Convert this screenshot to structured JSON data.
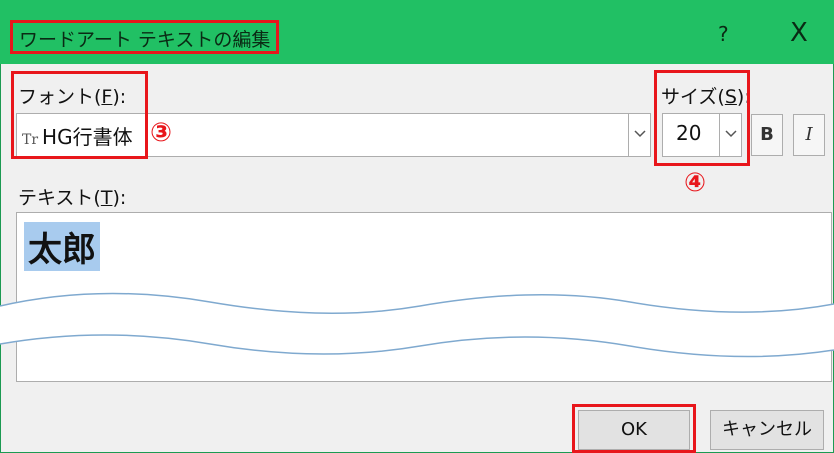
{
  "dialog": {
    "title": "ワードアート テキストの編集",
    "help_label": "?",
    "close_label": "X"
  },
  "font": {
    "label_prefix": "フォント(",
    "label_key": "F",
    "label_suffix": "):",
    "value": "HG行書体",
    "font_icon": "truetype-font-icon",
    "icon_glyph": "Tr",
    "marker": "③"
  },
  "size": {
    "label_prefix": "サイズ(",
    "label_key": "S",
    "label_suffix": "):",
    "value": "20",
    "marker": "④"
  },
  "format": {
    "bold_label": "B",
    "italic_label": "I"
  },
  "text": {
    "label_prefix": "テキスト(",
    "label_key": "T",
    "label_suffix": "):",
    "value": "太郎"
  },
  "buttons": {
    "ok_label": "OK",
    "cancel_label": "キャンセル"
  },
  "colors": {
    "title_bar": "#21c064",
    "highlight_box": "#e8161b",
    "selection": "#a8cbee"
  }
}
